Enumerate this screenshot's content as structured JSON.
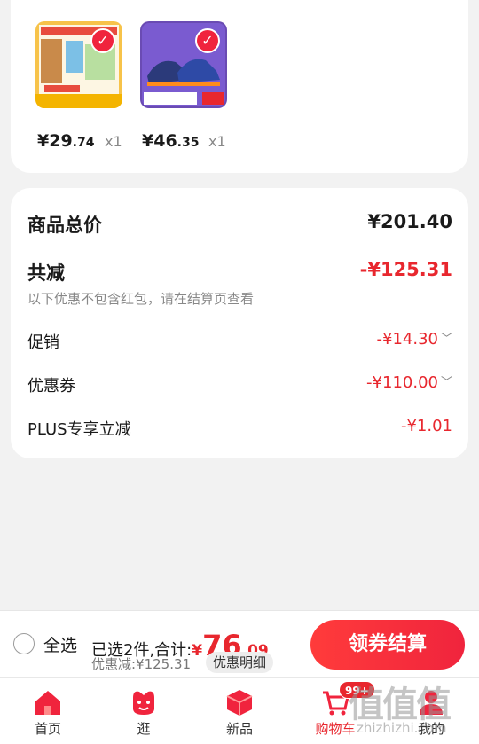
{
  "products": [
    {
      "price_int": "¥29",
      "price_dec": ".74",
      "qty": "x1",
      "image": "milk-product-image"
    },
    {
      "price_int": "¥46",
      "price_dec": ".35",
      "qty": "x1",
      "image": "sneakers-product-image"
    }
  ],
  "summary": {
    "goods_total_label": "商品总价",
    "goods_total_value": "¥201.40",
    "total_reduction_label": "共减",
    "total_reduction_value": "-¥125.31",
    "note": "以下优惠不包含红包，请在结算页查看",
    "promo_label": "促销",
    "promo_value": "-¥14.30",
    "coupon_label": "优惠券",
    "coupon_value": "-¥110.00",
    "plus_label": "PLUS专享立减",
    "plus_value": "-¥1.01"
  },
  "checkout": {
    "select_all_label": "全选",
    "selected_text": "已选2件,合计:",
    "total_symbol": "¥",
    "total_int": "76",
    "total_dec": ".09",
    "discount_text": "优惠减:¥125.31",
    "detail_label": "优惠明细",
    "button_label": "领券结算"
  },
  "tabs": [
    {
      "label": "首页",
      "icon": "home-icon"
    },
    {
      "label": "逛",
      "icon": "browse-icon"
    },
    {
      "label": "新品",
      "icon": "new-products-icon"
    },
    {
      "label": "购物车",
      "icon": "cart-icon",
      "badge": "99+"
    },
    {
      "label": "我的",
      "icon": "profile-icon"
    }
  ],
  "watermark": {
    "text": "值值值",
    "url": "zhizhizhi.com"
  },
  "colors": {
    "accent": "#e8272e",
    "background": "#f2f2f2"
  }
}
